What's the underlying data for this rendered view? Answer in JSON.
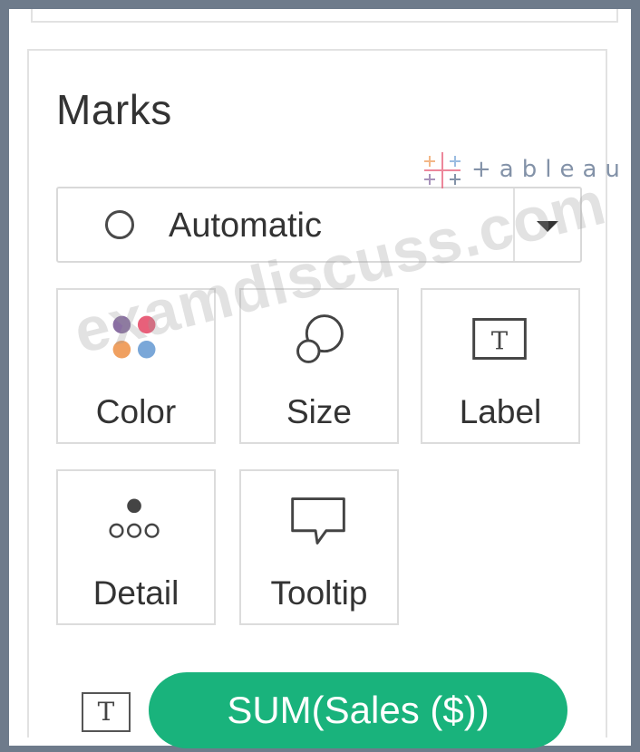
{
  "marks_card": {
    "title": "Marks",
    "mark_type": {
      "selected": "Automatic",
      "icon": "circle-icon"
    },
    "shelves": [
      {
        "label": "Color",
        "icon": "color-dots-icon",
        "colors": [
          "#8a6fa3",
          "#e8607a",
          "#f0a060",
          "#7aa7d8"
        ]
      },
      {
        "label": "Size",
        "icon": "size-circles-icon"
      },
      {
        "label": "Label",
        "icon": "text-box-icon"
      },
      {
        "label": "Detail",
        "icon": "detail-dots-icon"
      },
      {
        "label": "Tooltip",
        "icon": "speech-bubble-icon"
      }
    ],
    "field_pill": {
      "label": "SUM(Sales ($))",
      "type_icon": "text-box-icon",
      "type_glyph": "T",
      "color": "#19b37c"
    }
  },
  "watermarks": {
    "site": "examdiscuss.com",
    "brand": "+ableau"
  }
}
